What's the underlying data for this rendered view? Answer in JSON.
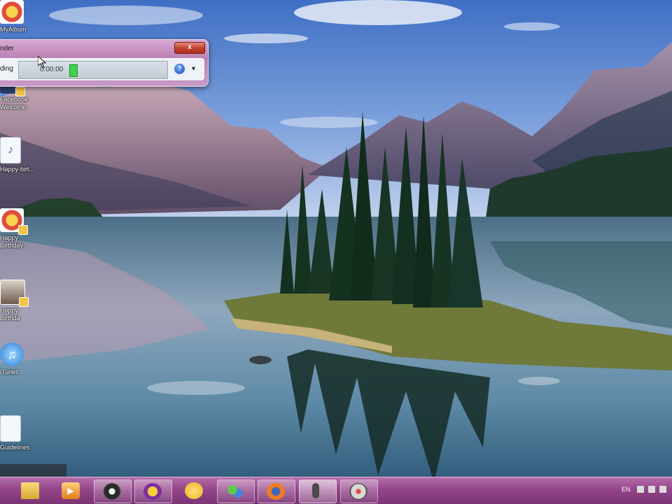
{
  "desktop": {
    "icons": [
      {
        "label": "MyAlbum"
      },
      {
        "label": "Facebook"
      },
      {
        "label": "Welcome"
      },
      {
        "label": "Happy-birt..."
      },
      {
        "label": "Happy"
      },
      {
        "label": "Birthday"
      },
      {
        "label": "Happy"
      },
      {
        "label": "Birthda"
      },
      {
        "label": "iTunes"
      },
      {
        "label": "Guidelines"
      }
    ]
  },
  "recorder": {
    "title": "nder",
    "status": "ding",
    "time": "0:00:00",
    "close_label": "x",
    "help_label": "?",
    "dropdown_label": "▼",
    "level": 0.25
  },
  "taskbar": {
    "language": "EN",
    "buttons": [
      {
        "name": "explorer"
      },
      {
        "name": "media-player"
      },
      {
        "name": "obs"
      },
      {
        "name": "yahoo-messenger"
      },
      {
        "name": "smiley-app"
      },
      {
        "name": "messenger"
      },
      {
        "name": "firefox"
      },
      {
        "name": "sound-recorder"
      },
      {
        "name": "media-tool"
      }
    ]
  },
  "colors": {
    "taskbar": "#93458a",
    "window_frame": "#c89ac6",
    "level_meter": "#3ed34a"
  }
}
